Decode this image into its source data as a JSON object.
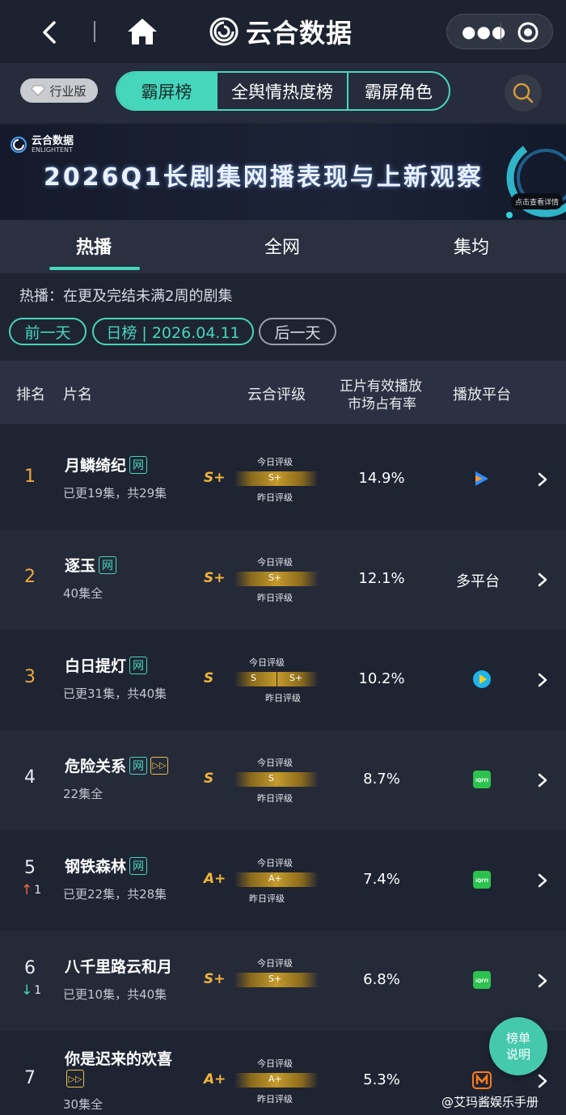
{
  "topbar": {
    "brand": "云合数据"
  },
  "catbar": {
    "industry": "行业版",
    "tabs": [
      "霸屏榜",
      "全舆情热度榜",
      "霸屏角色"
    ]
  },
  "banner": {
    "logo_name": "云合数据",
    "logo_en": "ENLIGHTENT",
    "title": "2026Q1长剧集网播表现与上新观察",
    "button": "点击查看详情"
  },
  "tabs": [
    "热播",
    "全网",
    "集均"
  ],
  "note": "热播：在更及完结未满2周的剧集",
  "date": {
    "prev": "前一天",
    "current": "日榜 | 2026.04.11",
    "next": "后一天"
  },
  "table_header": {
    "rank": "排名",
    "title": "片名",
    "grade": "云合评级",
    "share_line1": "正片有效播放",
    "share_line2": "市场占有率",
    "platform": "播放平台"
  },
  "grade_labels": {
    "today": "今日评级",
    "yesterday": "昨日评级"
  },
  "rows": [
    {
      "rank": "1",
      "title": "月鳞绮纪",
      "badges": [
        "网"
      ],
      "sub": "已更19集，共29集",
      "grade": "S+",
      "bar_today": "S+",
      "bar_yesterday": "",
      "share": "14.9%",
      "platform": "",
      "platform_icon": "tencent-video-icon"
    },
    {
      "rank": "2",
      "title": "逐玉",
      "badges": [
        "网"
      ],
      "sub": "40集全",
      "grade": "S+",
      "bar_today": "S+",
      "bar_yesterday": "",
      "share": "12.1%",
      "platform": "多平台",
      "platform_icon": ""
    },
    {
      "rank": "3",
      "title": "白日提灯",
      "badges": [
        "网"
      ],
      "sub": "已更31集，共40集",
      "grade": "S",
      "bar_today": "S",
      "bar_yesterday": "S+",
      "share": "10.2%",
      "platform": "",
      "platform_icon": "youku-icon"
    },
    {
      "rank": "4",
      "title": "危险关系",
      "badges": [
        "网",
        "▷▷"
      ],
      "sub": "22集全",
      "grade": "S",
      "bar_today": "S",
      "bar_yesterday": "",
      "share": "8.7%",
      "platform": "",
      "platform_icon": "iqiyi-icon"
    },
    {
      "rank": "5",
      "trend": "up",
      "trend_value": "1",
      "title": "钢铁森林",
      "badges": [
        "网"
      ],
      "sub": "已更22集，共28集",
      "grade": "A+",
      "bar_today": "A+",
      "bar_yesterday": "",
      "share": "7.4%",
      "platform": "",
      "platform_icon": "iqiyi-icon"
    },
    {
      "rank": "6",
      "trend": "down",
      "trend_value": "1",
      "title": "八千里路云和月",
      "badges": [],
      "sub": "已更10集，共40集",
      "grade": "S+",
      "bar_today": "S+",
      "bar_yesterday": "",
      "share": "6.8%",
      "platform": "",
      "platform_icon": "iqiyi-icon"
    },
    {
      "rank": "7",
      "title": "你是迟来的欢喜",
      "badges": [
        "▷▷"
      ],
      "sub": "30集全",
      "grade": "A+",
      "bar_today": "A+",
      "bar_yesterday": "",
      "share": "5.3%",
      "platform": "",
      "platform_icon": "mango-tv-icon"
    }
  ],
  "iqiyi_text": "iQIYI",
  "float_button": {
    "line1": "榜单",
    "line2": "说明"
  },
  "watermark": "@艾玛酱娱乐手册",
  "colors": {
    "accent": "#45d6bb",
    "gold": "#f0b43a",
    "background": "#1f2433"
  }
}
